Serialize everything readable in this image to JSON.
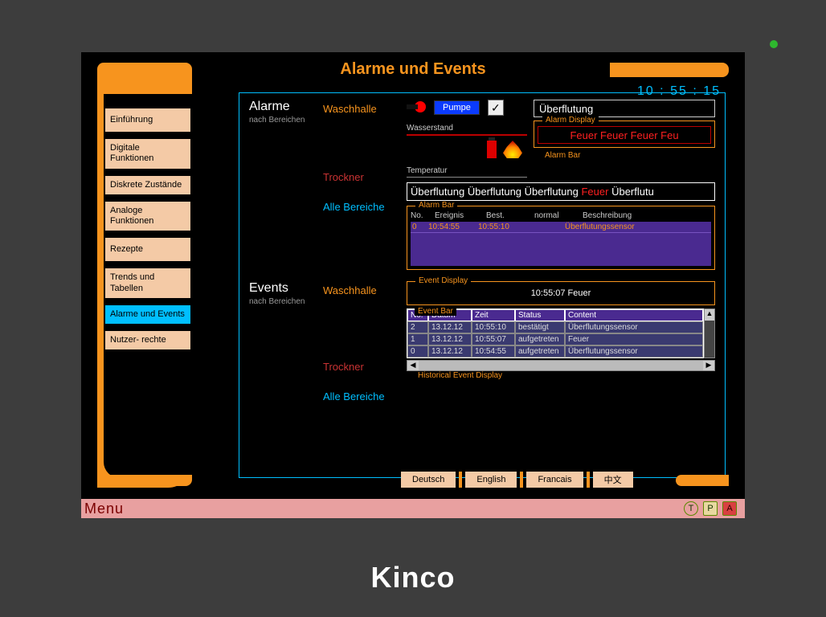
{
  "brand": "Kinco",
  "page": {
    "title": "Alarme und Events",
    "clock": "10 : 55 : 15"
  },
  "nav": {
    "items": [
      "Einführung",
      "Digitale Funktionen",
      "Diskrete Zustände",
      "Analoge Funktionen",
      "Rezepte",
      "Trends und Tabellen",
      "Alarme und Events",
      "Nutzer- rechte"
    ],
    "active_index": 6
  },
  "alarm_section": {
    "title": "Alarme",
    "subtitle": "nach Bereichen",
    "areas": [
      "Waschhalle",
      "Trockner",
      "Alle Bereiche"
    ],
    "pump_button": "Pumpe",
    "checkbox": "✓",
    "level_label": "Wasserstand",
    "temp_label": "Temperatur",
    "current_alarm": "Überflutung",
    "display_group": "Alarm Display",
    "display_text": "Feuer Feuer Feuer Feu",
    "bar_group": "Alarm Bar",
    "bar_text_plain": "Überflutung Überflutung Überflutung",
    "bar_text_fire": "Feuer",
    "bar_text_tail": "Überflutu",
    "lower_bar_group": "Alarm Bar",
    "event_header": {
      "no": "No.",
      "ereignis": "Ereignis",
      "best": "Best.",
      "normal": "normal",
      "beschr": "Beschreibung"
    },
    "event_row": {
      "no": "0",
      "ereignis": "10:54:55",
      "best": "10:55:10",
      "normal": "",
      "beschr": "Überflutungssensor"
    }
  },
  "event_section": {
    "title": "Events",
    "subtitle": "nach Bereichen",
    "areas": [
      "Waschhalle",
      "Trockner",
      "Alle Bereiche"
    ],
    "display_group": "Event Display",
    "display_line": "10:55:07   Feuer",
    "bar_group": "Event Bar",
    "table_head": {
      "no": "No.",
      "datum": "Datum",
      "zeit": "Zeit",
      "status": "Status",
      "content": "Content"
    },
    "rows": [
      {
        "no": "2",
        "datum": "13.12.12",
        "zeit": "10:55:10",
        "status": "bestätigt",
        "content": "Überflutungssensor"
      },
      {
        "no": "1",
        "datum": "13.12.12",
        "zeit": "10:55:07",
        "status": "aufgetreten",
        "content": "Feuer"
      },
      {
        "no": "0",
        "datum": "13.12.12",
        "zeit": "10:54:55",
        "status": "aufgetreten",
        "content": "Überflutungssensor"
      }
    ],
    "hist_group": "Historical Event Display"
  },
  "languages": [
    "Deutsch",
    "English",
    "Francais",
    "中文"
  ],
  "status_bar": {
    "label": "Menu",
    "chips": [
      "T",
      "P",
      "A"
    ]
  }
}
